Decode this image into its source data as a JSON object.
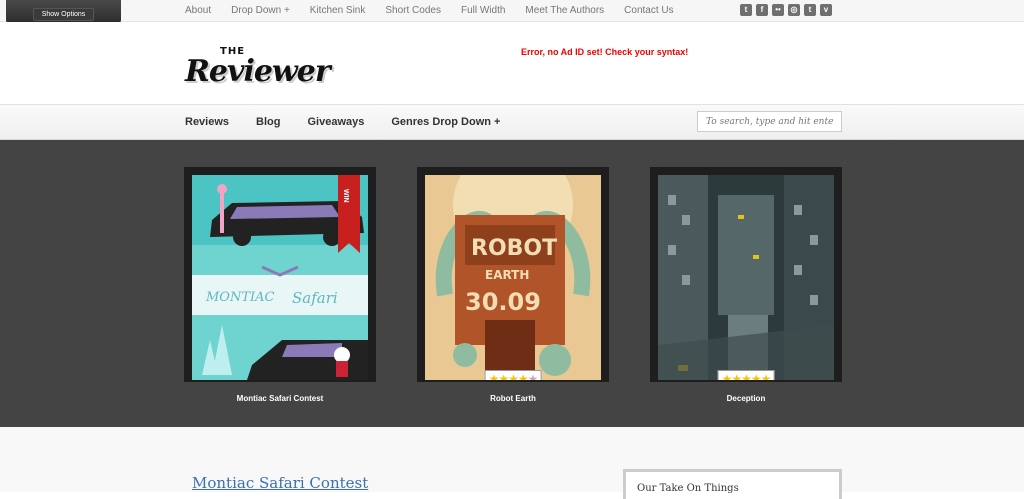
{
  "topbar": {
    "show_options": "Show Options",
    "nav": [
      "About",
      "Drop Down +",
      "Kitchen Sink",
      "Short Codes",
      "Full Width",
      "Meet The Authors",
      "Contact Us"
    ],
    "social": [
      {
        "icon": "twitter-icon",
        "glyph": "t"
      },
      {
        "icon": "facebook-icon",
        "glyph": "f"
      },
      {
        "icon": "flickr-icon",
        "glyph": "••"
      },
      {
        "icon": "dribbble-icon",
        "glyph": "◎"
      },
      {
        "icon": "tumblr-icon",
        "glyph": "t"
      },
      {
        "icon": "vimeo-icon",
        "glyph": "v"
      }
    ]
  },
  "header": {
    "logo_the": "THE",
    "logo_name": "Reviewer",
    "ad_error": "Error, no Ad ID set! Check your syntax!"
  },
  "mainnav": {
    "items": [
      "Reviews",
      "Blog",
      "Giveaways",
      "Genres Drop Down +"
    ],
    "search_placeholder": "To search, type and hit enter"
  },
  "featured": [
    {
      "title": "Montiac Safari Contest",
      "ribbon": "WIN",
      "rating_stars": null
    },
    {
      "title": "Robot Earth",
      "ribbon": null,
      "rating_stars": 4.5
    },
    {
      "title": "Deception",
      "ribbon": null,
      "rating_stars": 5
    }
  ],
  "content": {
    "post_title": "Montiac Safari Contest",
    "sidebar_title": "Our Take On Things"
  },
  "colors": {
    "accent_blue": "#3c6fb3",
    "ribbon_red": "#c81f1f",
    "star_yellow": "#f4c400",
    "featured_bg": "#444444"
  }
}
